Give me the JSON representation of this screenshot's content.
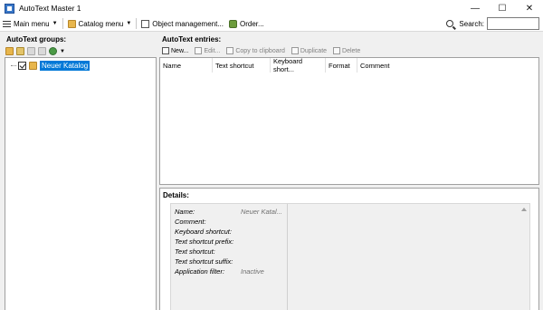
{
  "window": {
    "title": "AutoText Master 1",
    "minimize": "—",
    "maximize": "☐",
    "close": "✕"
  },
  "menubar": {
    "main_menu": "Main menu",
    "catalog_menu": "Catalog menu",
    "object_management": "Object management...",
    "order": "Order...",
    "search_label": "Search:",
    "search_value": ""
  },
  "left": {
    "title": "AutoText groups:",
    "tree": [
      {
        "label": "Neuer Katalog",
        "checked": true,
        "selected": true
      }
    ]
  },
  "right": {
    "title": "AutoText entries:",
    "toolbar": {
      "new": "New...",
      "edit": "Edit...",
      "copy": "Copy to clipboard",
      "duplicate": "Duplicate",
      "delete": "Delete"
    },
    "columns": [
      "Name",
      "Text shortcut",
      "Keyboard short...",
      "Format",
      "Comment"
    ]
  },
  "details": {
    "title": "Details:",
    "props": [
      {
        "label": "Name:",
        "value": "Neuer Katal..."
      },
      {
        "label": "Comment:",
        "value": ""
      },
      {
        "label": "Keyboard shortcut:",
        "value": ""
      },
      {
        "label": "Text shortcut prefix:",
        "value": ""
      },
      {
        "label": "Text shortcut:",
        "value": ""
      },
      {
        "label": "Text shortcut suffix:",
        "value": ""
      },
      {
        "label": "Application filter:",
        "value": "Inactive"
      }
    ]
  },
  "colors": {
    "selection": "#0078d7",
    "panel_bg": "#ffffff",
    "window_bg": "#f0f0f0"
  }
}
